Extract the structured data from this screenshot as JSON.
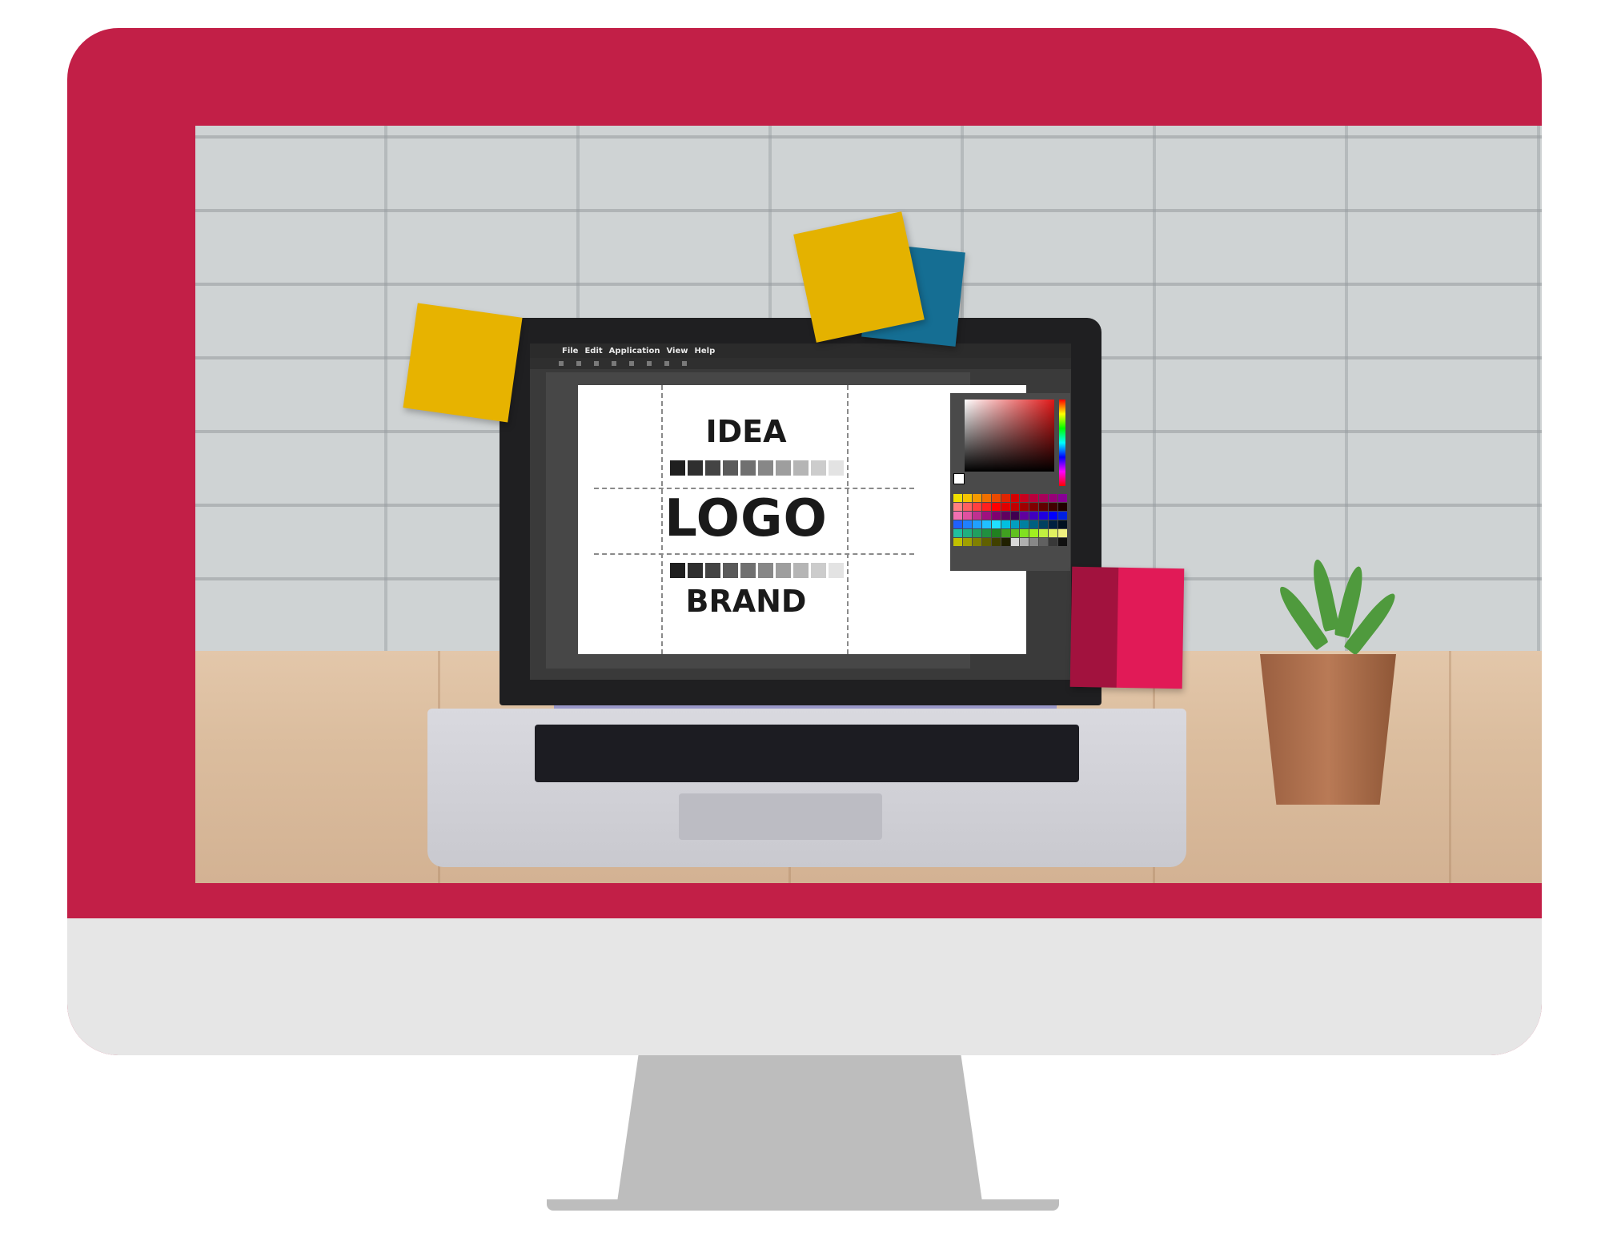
{
  "menu": [
    "File",
    "Edit",
    "Application",
    "View",
    "Help"
  ],
  "artboard": {
    "words": {
      "idea": "IDEA",
      "logo": "LOGO",
      "brand": "BRAND"
    }
  },
  "colors": {
    "monitor_frame": "#c21f47",
    "monitor_chin": "#e6e6e6",
    "stand": "#bdbdbd",
    "sticky_yellow": "#e7b300",
    "sticky_blue": "#156e93",
    "sticky_pink": "#e11a57"
  },
  "swatches": [
    "#1f1f1f",
    "#2f2f2f",
    "#444444",
    "#5a5a5a",
    "#707070",
    "#878787",
    "#9e9e9e",
    "#b5b5b5",
    "#cccccc",
    "#e3e3e3"
  ],
  "palette": [
    "#f0e000",
    "#f5c400",
    "#f59a00",
    "#f07000",
    "#ea4a00",
    "#e02400",
    "#d60000",
    "#c8001e",
    "#b8003c",
    "#a8005a",
    "#980078",
    "#880096",
    "#ff8080",
    "#ff6060",
    "#ff4040",
    "#ff2020",
    "#ff0000",
    "#e00000",
    "#c00000",
    "#a00000",
    "#800000",
    "#600000",
    "#400000",
    "#200000",
    "#f070b0",
    "#e050a0",
    "#c03090",
    "#a01080",
    "#800070",
    "#600060",
    "#400050",
    "#6000a0",
    "#4000c0",
    "#2000e0",
    "#0000ff",
    "#0020e0",
    "#2060ff",
    "#2080ff",
    "#20a0ff",
    "#20c0ff",
    "#20e0ff",
    "#00c0e0",
    "#00a0c0",
    "#0080a0",
    "#006080",
    "#004060",
    "#002040",
    "#001020",
    "#20c0a0",
    "#20b080",
    "#20a060",
    "#209040",
    "#208020",
    "#40a020",
    "#60c020",
    "#80e020",
    "#a0f020",
    "#c0f040",
    "#e0f060",
    "#f0f080",
    "#c0c000",
    "#a0a000",
    "#808000",
    "#606000",
    "#404000",
    "#202000",
    "#d8d8d8",
    "#b0b0b0",
    "#888888",
    "#606060",
    "#383838",
    "#101010"
  ]
}
